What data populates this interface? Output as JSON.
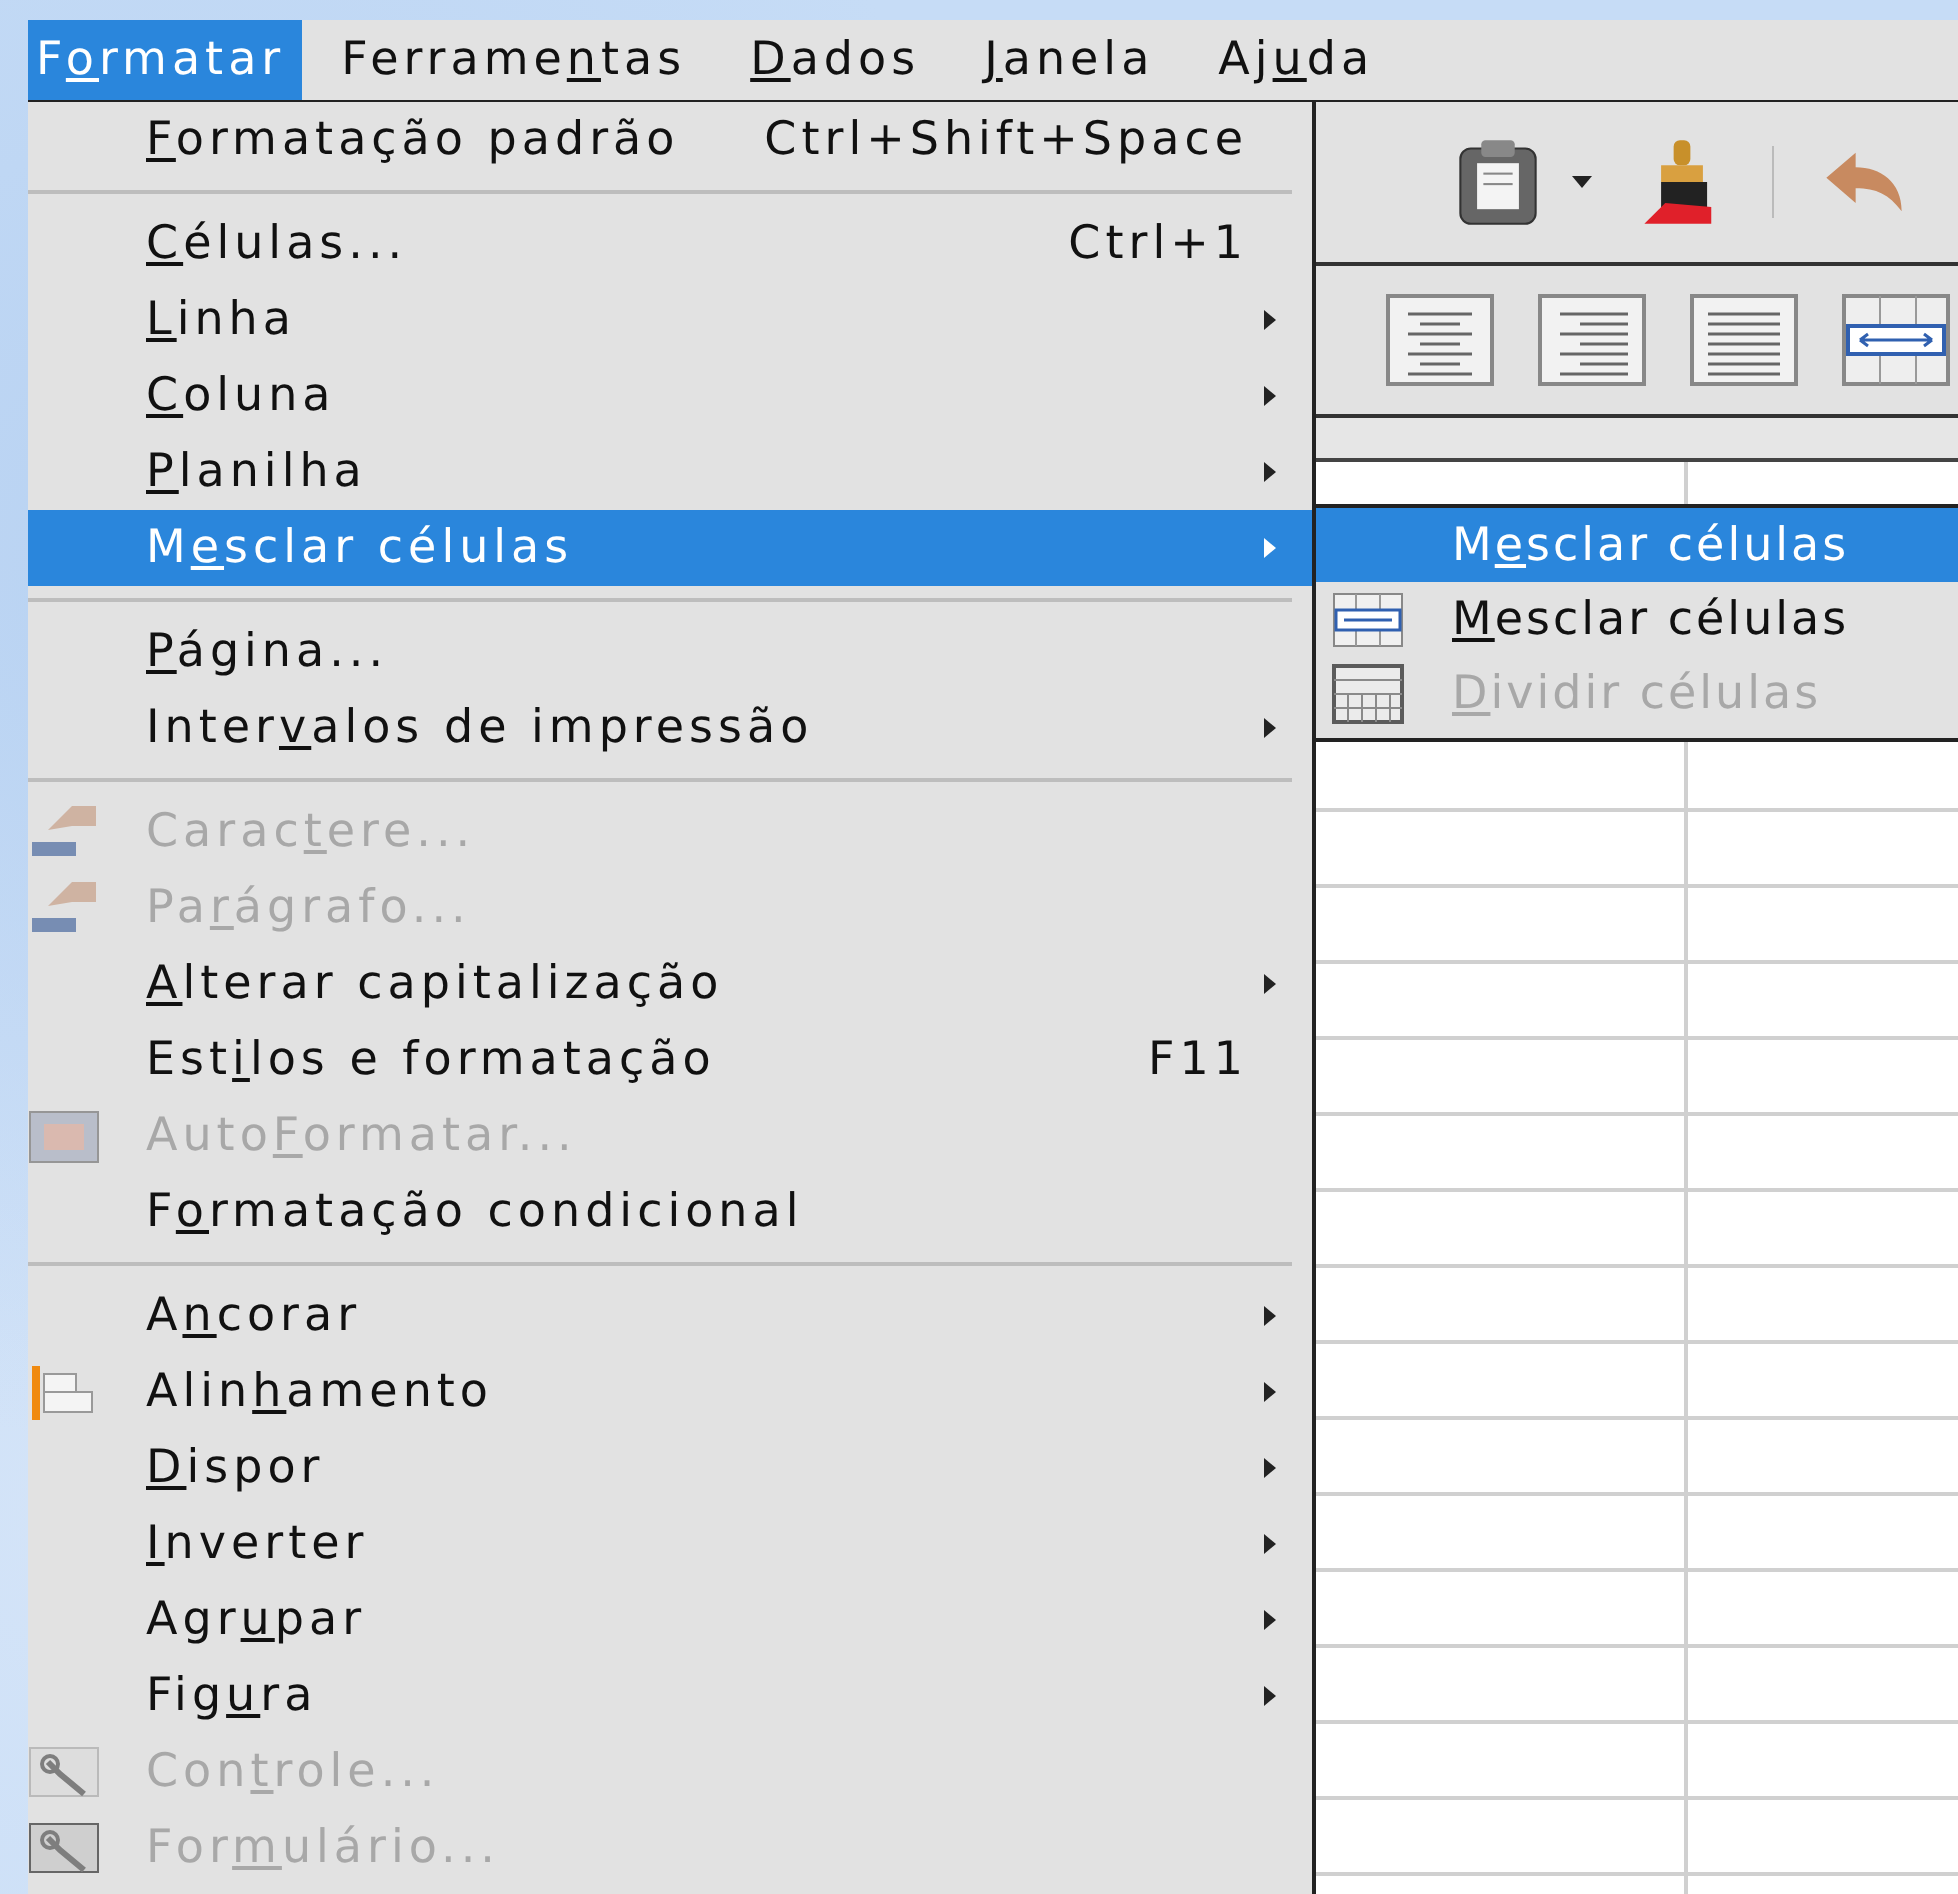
{
  "menubar": [
    {
      "label_start": "F",
      "mnemonic": "o",
      "label_end": "rmatar",
      "selected": true
    },
    {
      "label_start": "Ferrame",
      "mnemonic": "n",
      "label_end": "tas",
      "selected": false
    },
    {
      "mnemonic": "D",
      "label_end": "ados",
      "selected": false
    },
    {
      "mnemonic": "J",
      "label_end": "anela",
      "selected": false
    },
    {
      "label_start": "Aj",
      "mnemonic": "u",
      "label_end": "da",
      "selected": false
    }
  ],
  "menu": {
    "items": [
      {
        "kind": "item",
        "mnemonic": "F",
        "label_end": "ormatação padrão",
        "shortcut": "Ctrl+Shift+Space",
        "submenu": false,
        "disabled": false,
        "selected": false
      },
      {
        "kind": "separator"
      },
      {
        "kind": "item",
        "mnemonic": "C",
        "label_end": "élulas...",
        "shortcut": "Ctrl+1",
        "submenu": false,
        "disabled": false,
        "selected": false
      },
      {
        "kind": "item",
        "mnemonic": "L",
        "label_end": "inha",
        "submenu": true,
        "disabled": false,
        "selected": false
      },
      {
        "kind": "item",
        "mnemonic": "C",
        "label_end": "oluna",
        "submenu": true,
        "disabled": false,
        "selected": false
      },
      {
        "kind": "item",
        "mnemonic": "P",
        "label_end": "lanilha",
        "submenu": true,
        "disabled": false,
        "selected": false
      },
      {
        "kind": "item",
        "label_start": "M",
        "mnemonic": "e",
        "label_end": "sclar células",
        "submenu": true,
        "disabled": false,
        "selected": true
      },
      {
        "kind": "separator"
      },
      {
        "kind": "item",
        "mnemonic": "P",
        "label_end": "ágina...",
        "submenu": false,
        "disabled": false,
        "selected": false
      },
      {
        "kind": "item",
        "label_start": "Inter",
        "mnemonic": "v",
        "label_end": "alos de impressão",
        "submenu": true,
        "disabled": false,
        "selected": false
      },
      {
        "kind": "separator"
      },
      {
        "kind": "item",
        "label_start": "Carac",
        "mnemonic": "t",
        "label_end": "ere...",
        "submenu": false,
        "disabled": true,
        "selected": false
      },
      {
        "kind": "item",
        "label_start": "Pa",
        "mnemonic": "r",
        "label_end": "ágrafo...",
        "submenu": false,
        "disabled": true,
        "selected": false
      },
      {
        "kind": "item",
        "mnemonic": "A",
        "label_end": "lterar capitalização",
        "submenu": true,
        "disabled": false,
        "selected": false
      },
      {
        "kind": "item",
        "label_start": "Est",
        "mnemonic": "i",
        "label_end": "los e formatação",
        "shortcut": "F11",
        "submenu": false,
        "disabled": false,
        "selected": false
      },
      {
        "kind": "item",
        "label_start": "Auto",
        "mnemonic": "F",
        "label_end": "ormatar...",
        "submenu": false,
        "disabled": true,
        "selected": false
      },
      {
        "kind": "item",
        "label_start": "F",
        "mnemonic": "o",
        "label_end": "rmatação condicional",
        "submenu": false,
        "disabled": false,
        "selected": false
      },
      {
        "kind": "separator"
      },
      {
        "kind": "item",
        "label_start": "A",
        "mnemonic": "n",
        "label_end": "corar",
        "submenu": true,
        "disabled": false,
        "selected": false
      },
      {
        "kind": "item",
        "label_start": "Alin",
        "mnemonic": "h",
        "label_end": "amento",
        "submenu": true,
        "disabled": false,
        "selected": false
      },
      {
        "kind": "item",
        "mnemonic": "D",
        "label_end": "ispor",
        "submenu": true,
        "disabled": false,
        "selected": false
      },
      {
        "kind": "item",
        "mnemonic": "I",
        "label_end": "nverter",
        "submenu": true,
        "disabled": false,
        "selected": false
      },
      {
        "kind": "item",
        "label_start": "Agr",
        "mnemonic": "u",
        "label_end": "par",
        "submenu": true,
        "disabled": false,
        "selected": false
      },
      {
        "kind": "item",
        "label_start": "Fig",
        "mnemonic": "u",
        "label_end": "ra",
        "submenu": true,
        "disabled": false,
        "selected": false
      },
      {
        "kind": "item",
        "label_start": "Con",
        "mnemonic": "t",
        "label_end": "role...",
        "submenu": false,
        "disabled": true,
        "selected": false
      },
      {
        "kind": "item",
        "label_start": "For",
        "mnemonic": "m",
        "label_end": "ulário...",
        "submenu": false,
        "disabled": true,
        "selected": false
      }
    ]
  },
  "submenu": {
    "items": [
      {
        "label_start": "M",
        "mnemonic": "e",
        "label_end": "sclar células",
        "disabled": false,
        "selected": true
      },
      {
        "mnemonic": "M",
        "label_end": "esclar células",
        "disabled": false,
        "selected": false
      },
      {
        "mnemonic": "D",
        "label_end": "ividir células",
        "disabled": true,
        "selected": false
      }
    ]
  }
}
